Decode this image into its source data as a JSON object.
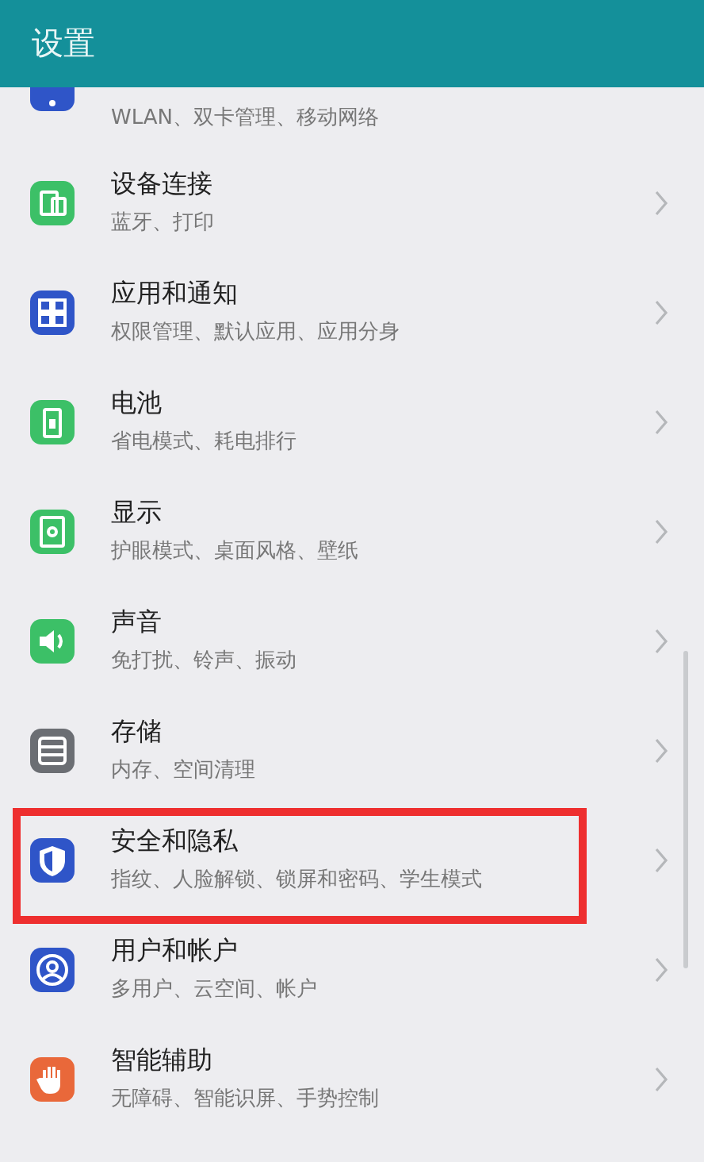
{
  "header": {
    "title": "设置"
  },
  "items": [
    {
      "subtitle": "WLAN、双卡管理、移动网络",
      "color": "#2f55c8",
      "highlighted": false
    },
    {
      "title": "设备连接",
      "subtitle": "蓝牙、打印",
      "color": "#3cc067",
      "highlighted": false
    },
    {
      "title": "应用和通知",
      "subtitle": "权限管理、默认应用、应用分身",
      "color": "#2f55c8",
      "highlighted": false
    },
    {
      "title": "电池",
      "subtitle": "省电模式、耗电排行",
      "color": "#3cc067",
      "highlighted": false
    },
    {
      "title": "显示",
      "subtitle": "护眼模式、桌面风格、壁纸",
      "color": "#3cc067",
      "highlighted": false
    },
    {
      "title": "声音",
      "subtitle": "免打扰、铃声、振动",
      "color": "#3cc067",
      "highlighted": false
    },
    {
      "title": "存储",
      "subtitle": "内存、空间清理",
      "color": "#6b6e73",
      "highlighted": false
    },
    {
      "title": "安全和隐私",
      "subtitle": "指纹、人脸解锁、锁屏和密码、学生模式",
      "color": "#2f55c8",
      "highlighted": true
    },
    {
      "title": "用户和帐户",
      "subtitle": "多用户、云空间、帐户",
      "color": "#2f55c8",
      "highlighted": false
    },
    {
      "title": "智能辅助",
      "subtitle": "无障碍、智能识屏、手势控制",
      "color": "#e9683a",
      "highlighted": false
    }
  ]
}
